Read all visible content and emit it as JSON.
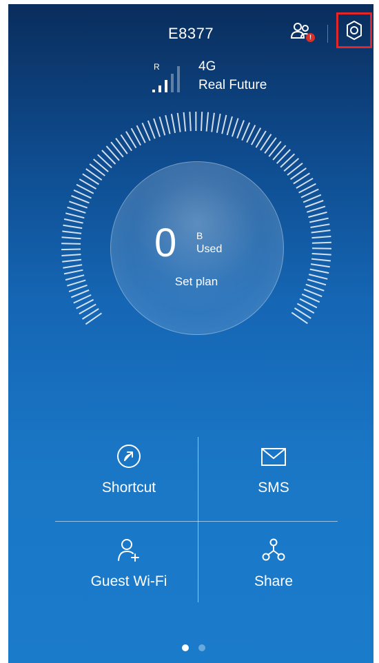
{
  "header": {
    "device_name": "E8377",
    "user_badge": "!",
    "icons": {
      "user": "user-group-icon",
      "settings": "gear-icon"
    }
  },
  "signal": {
    "roaming": "R",
    "network_type": "4G",
    "carrier": "Real Future",
    "bars_active": 3,
    "bars_total": 5
  },
  "usage": {
    "value": "0",
    "unit": "B",
    "label": "Used",
    "plan_link": "Set plan"
  },
  "tiles": [
    {
      "label": "Shortcut",
      "icon": "shortcut-icon"
    },
    {
      "label": "SMS",
      "icon": "envelope-icon"
    },
    {
      "label": "Guest Wi-Fi",
      "icon": "add-user-icon"
    },
    {
      "label": "Share",
      "icon": "share-icon"
    }
  ],
  "pager": {
    "pages": 2,
    "current": 1
  },
  "colors": {
    "highlight": "#e3262a",
    "badge": "#d9302a",
    "gradient_top": "#0a2d5c",
    "gradient_bottom": "#1b7bcb"
  }
}
